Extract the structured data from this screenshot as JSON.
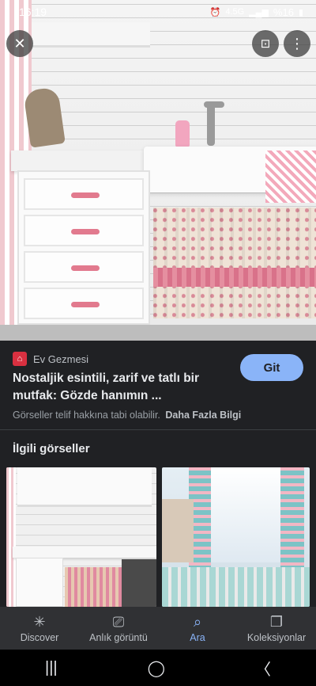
{
  "status_bar": {
    "time": "16:19",
    "network": "4.5G",
    "battery": "%16"
  },
  "hero": {
    "close_icon": "close-icon",
    "lens_icon": "lens-icon",
    "more_icon": "more-vert-icon"
  },
  "result": {
    "source": "Ev Gezmesi",
    "title": "Nostaljik esintili, zarif ve tatlı bir mutfak: Gözde hanımın ...",
    "go_button": "Git",
    "copyright": "Görseller telif hakkına tabi olabilir.",
    "more_info": "Daha Fazla Bilgi"
  },
  "related": {
    "heading": "İlgili görseller"
  },
  "bottom_nav": {
    "items": [
      {
        "label": "Discover",
        "icon": "asterisk-icon"
      },
      {
        "label": "Anlık görüntü",
        "icon": "snapshot-icon"
      },
      {
        "label": "Ara",
        "icon": "search-icon"
      },
      {
        "label": "Koleksiyonlar",
        "icon": "collections-icon"
      }
    ],
    "active": "Ara"
  },
  "colors": {
    "accent": "#8ab4f8",
    "background": "#202124",
    "source_logo": "#d93040"
  }
}
